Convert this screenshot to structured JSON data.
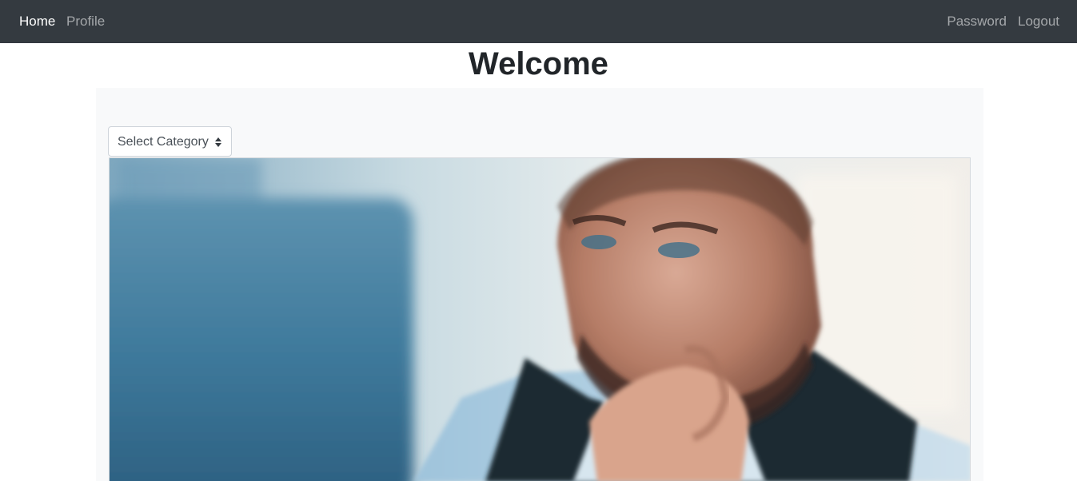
{
  "navbar": {
    "home": "Home",
    "profile": "Profile",
    "password": "Password",
    "logout": "Logout"
  },
  "page": {
    "title": "Welcome"
  },
  "category_select": {
    "selected": "Select Category"
  },
  "hero_image": {
    "subject": "man-at-computer-photo"
  },
  "colors": {
    "navbar_bg": "#343a40",
    "panel_bg": "#f8f9fa",
    "title_text": "#212529"
  }
}
